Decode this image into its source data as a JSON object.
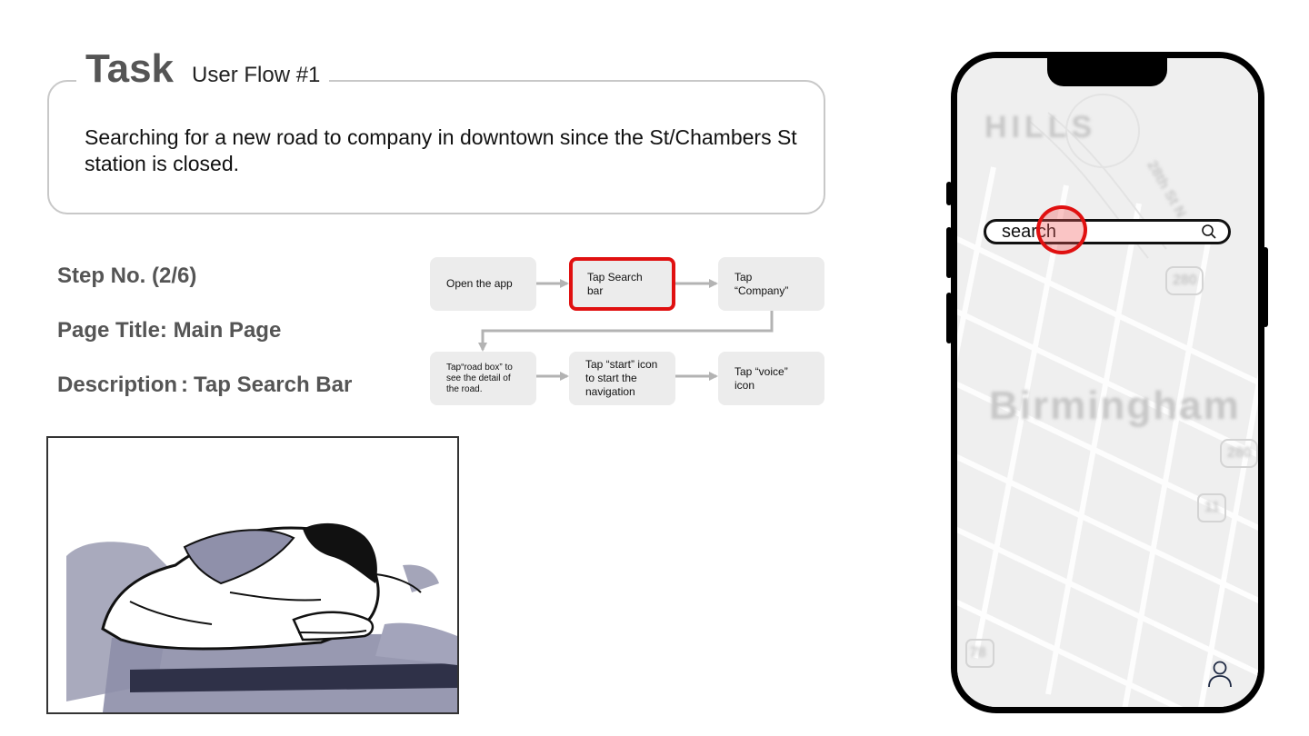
{
  "task": {
    "title": "Task",
    "subtitle": "User Flow #1",
    "description": "Searching for a new road to company in downtown since the St/Chambers St station is closed."
  },
  "step": {
    "number": "Step No. (2/6)",
    "page_title": "Page Title: Main Page",
    "description_label": "Description",
    "description_sep": ":",
    "description_value": "Tap Search Bar"
  },
  "flow": {
    "nodes": [
      {
        "label": "Open the app"
      },
      {
        "label": "Tap Search bar",
        "active": true
      },
      {
        "label": "Tap “Company”"
      },
      {
        "label": "Tap“road box” to see the detail of the road."
      },
      {
        "label": "Tap “start” icon to start the navigation"
      },
      {
        "label": "Tap “voice” icon"
      }
    ]
  },
  "phone": {
    "search_text": "search",
    "map_labels": [
      "HILLS",
      "28th St N",
      "Birmingham",
      "280",
      "280",
      "11",
      "78"
    ]
  },
  "colors": {
    "highlight": "#e01010",
    "node_bg": "#ececec",
    "arrow": "#b3b3b3"
  }
}
